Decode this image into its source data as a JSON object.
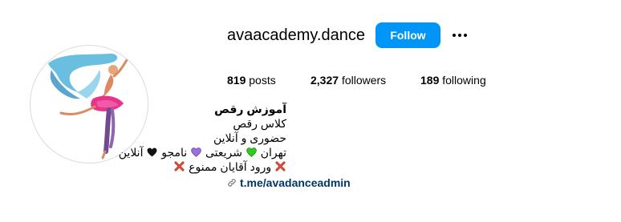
{
  "profile": {
    "username": "avaacademy.dance",
    "follow_label": "Follow",
    "more_icon": "more-options-icon"
  },
  "stats": {
    "posts_count": "819",
    "posts_label": "posts",
    "followers_count": "2,327",
    "followers_label": "followers",
    "following_count": "189",
    "following_label": "following"
  },
  "bio": {
    "name": "آموزش رقص",
    "line1": "کلاس رقص",
    "line2": "حضوری و آنلاین",
    "line3_a": "تهران",
    "line3_b": "شریعتی",
    "line3_c": "نامجو",
    "line3_d": "آنلاین",
    "line4": "ورود آقایان ممنوع",
    "link": "t.me/avadanceadmin"
  },
  "colors": {
    "follow_button": "#0095f6",
    "link": "#00376b",
    "heart_green": "#2ecc1f",
    "heart_purple": "#9b6fe0",
    "heart_black": "#111111",
    "cross": "#c0392b"
  }
}
